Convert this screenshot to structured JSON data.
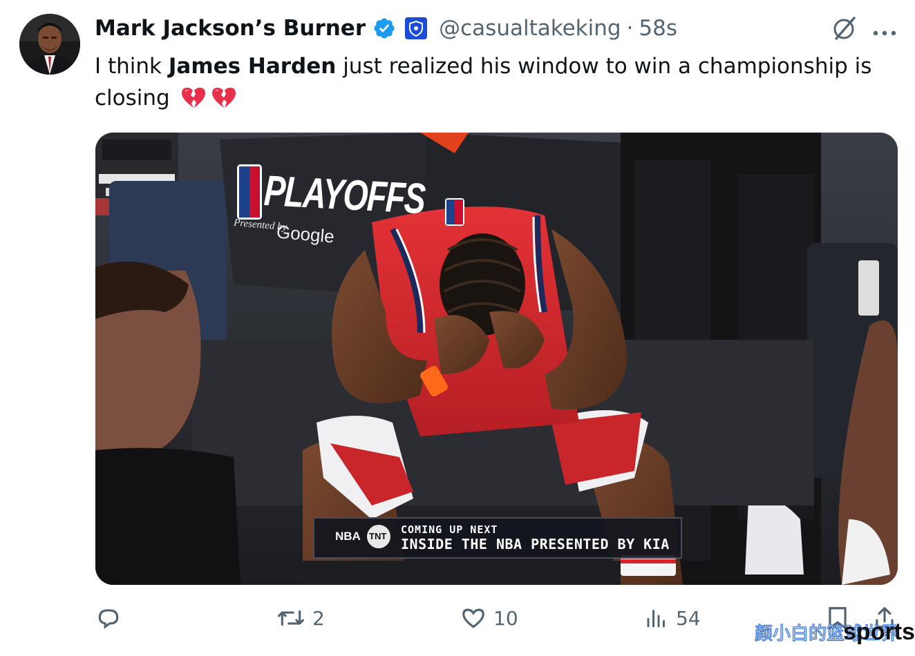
{
  "author": {
    "display_name": "Mark Jackson’s Burner",
    "handle": "@casualtakeking",
    "separator": "·",
    "timestamp": "58s"
  },
  "tweet": {
    "text_before": "I think ",
    "text_bold": "James Harden",
    "text_after": " just realized his window to win a championship is closing",
    "emoji": [
      "broken-heart",
      "broken-heart"
    ]
  },
  "media": {
    "signage": {
      "playoffs": "PLAYOFFS",
      "presented_by": "Presented by",
      "sponsor": "Google"
    },
    "ticker": {
      "line1": "COMING UP NEXT",
      "line2": "INSIDE THE NBA PRESENTED BY KIA",
      "logo_left": "NBA",
      "logo_right": "TNT"
    }
  },
  "actions": {
    "reply_count": "",
    "retweet_count": "2",
    "like_count": "10",
    "views_count": "54"
  },
  "watermark": {
    "cn_text": "颜小白的篮球世界",
    "en_text": "sports"
  },
  "icons": {
    "verified": "verified-badge-icon",
    "affiliate": "affiliate-shield-icon",
    "grok": "grok-icon",
    "more": "more-icon",
    "reply": "reply-icon",
    "retweet": "retweet-icon",
    "like": "heart-icon",
    "views": "views-icon",
    "bookmark": "bookmark-icon",
    "share": "share-icon"
  },
  "colors": {
    "text_primary": "#0f1419",
    "text_secondary": "#536471",
    "verified_blue": "#1d9bf0",
    "affiliate_blue": "#1a4cd8",
    "heart_red": "#e8304a",
    "jersey_red": "#d9292c"
  }
}
